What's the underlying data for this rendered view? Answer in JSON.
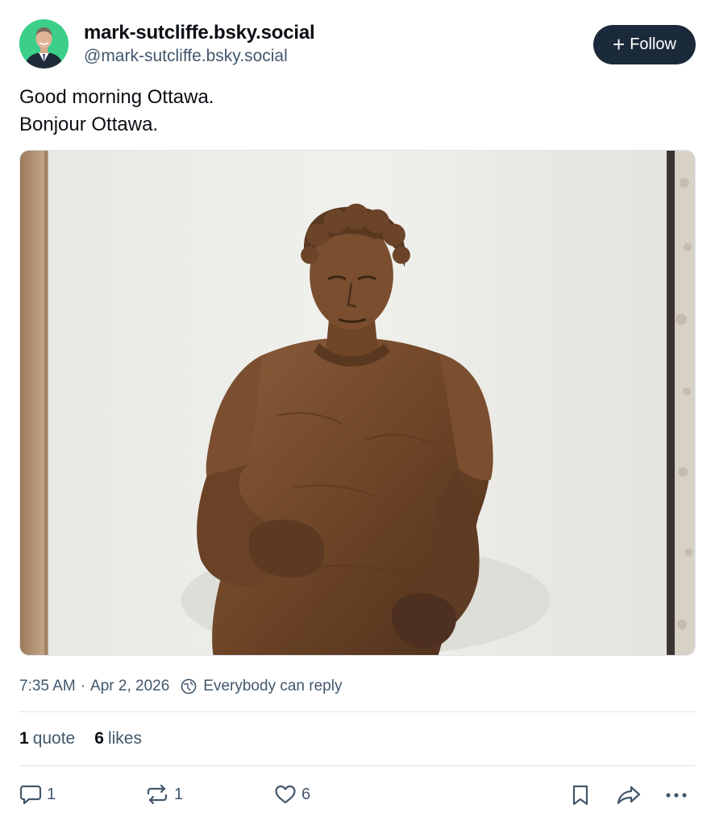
{
  "author": {
    "display_name": "mark-sutcliffe.bsky.social",
    "handle": "@mark-sutcliffe.bsky.social"
  },
  "follow_button": {
    "label": "Follow",
    "icon": "plus-icon"
  },
  "post": {
    "lines": [
      "Good morning Ottawa.",
      "Bonjour Ottawa."
    ],
    "image_icon": "bronze-statue-photo"
  },
  "meta": {
    "time": "7:35 AM",
    "separator": "·",
    "date": "Apr 2, 2026",
    "reply_setting_icon": "globe-icon",
    "reply_setting": "Everybody can reply"
  },
  "stats": {
    "quotes": {
      "count": "1",
      "label": "quote"
    },
    "likes": {
      "count": "6",
      "label": "likes"
    }
  },
  "actions": {
    "reply": {
      "icon": "reply-icon",
      "count": "1"
    },
    "repost": {
      "icon": "repost-icon",
      "count": "1"
    },
    "like": {
      "icon": "heart-icon",
      "count": "6"
    },
    "bookmark": {
      "icon": "bookmark-icon"
    },
    "share": {
      "icon": "share-icon"
    },
    "more": {
      "icon": "more-icon"
    }
  },
  "colors": {
    "text_primary": "#0b0f14",
    "text_secondary": "#42576c",
    "follow_bg": "#1b2a3a",
    "avatar_bg": "#3ccf8a",
    "divider": "#dfe4ea"
  }
}
